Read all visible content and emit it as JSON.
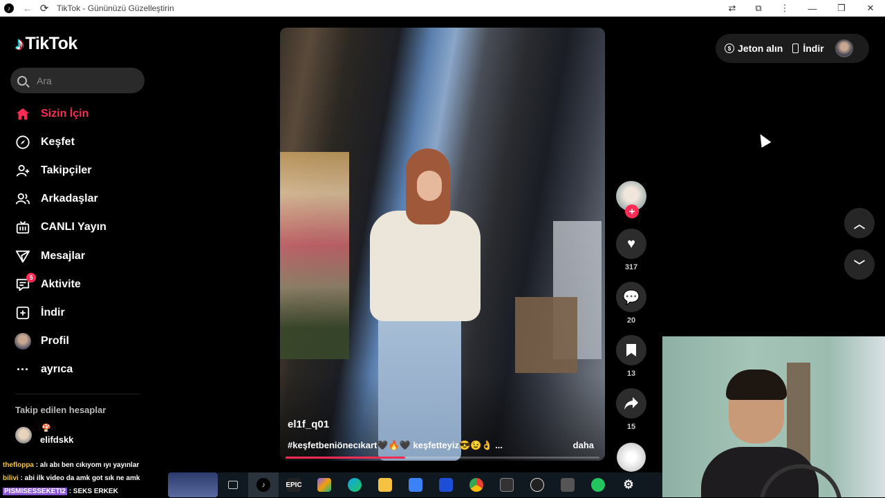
{
  "browser": {
    "title": "TikTok - Gününüzü Güzelleştirin",
    "app_icon": "tiktok-icon",
    "back_icon": "arrow-left-icon",
    "reload_icon": "reload-icon",
    "extension_icons": [
      "translate-icon",
      "puzzle-icon",
      "more-vertical-icon"
    ],
    "window_buttons": [
      "minimize-icon",
      "restore-icon",
      "close-icon"
    ]
  },
  "logo": {
    "text": "TikTok"
  },
  "search": {
    "placeholder": "Ara"
  },
  "sidebar": {
    "items": [
      {
        "label": "Sizin İçin",
        "icon": "home-icon",
        "active": true
      },
      {
        "label": "Keşfet",
        "icon": "compass-icon"
      },
      {
        "label": "Takipçiler",
        "icon": "user-add-icon"
      },
      {
        "label": "Arkadaşlar",
        "icon": "friends-icon"
      },
      {
        "label": "CANLI Yayın",
        "icon": "live-tv-icon"
      },
      {
        "label": "Mesajlar",
        "icon": "send-icon"
      },
      {
        "label": "Aktivite",
        "icon": "activity-icon",
        "badge": "5"
      },
      {
        "label": "İndir",
        "icon": "plus-square-icon"
      },
      {
        "label": "Profil",
        "icon": "avatar"
      },
      {
        "label": "ayrıca",
        "icon": "more-horizontal-icon"
      }
    ],
    "following_title": "Takip edilen hesaplar",
    "following": [
      {
        "name": "elifdskk",
        "emoji": "🍄"
      }
    ]
  },
  "video": {
    "username": "el1f_q01",
    "caption": "#keşfetbeniönecıkart🖤🔥🖤 keşfetteyiz😎😉👌 ...",
    "more_label": "daha",
    "progress": 0.38
  },
  "actions": {
    "likes": "317",
    "comments": "20",
    "saves": "13",
    "shares": "15"
  },
  "topbar": {
    "coins_label": "Jeton alın",
    "download_label": "İndir"
  },
  "chat": [
    {
      "user": "thefloppa",
      "message": ": alı abı ben cıkıyom ıyı yayınlar"
    },
    {
      "user": "bilivi",
      "message": ": abi ilk video da amk got sık ne amk"
    },
    {
      "user": "PISMISESSEKETI2",
      "message": ": SEKS ERKEK"
    }
  ],
  "taskbar": {
    "icons": [
      "task-view-icon",
      "tiktok-icon",
      "epic-games-icon",
      "copilot-icon",
      "edge-icon",
      "file-explorer-icon",
      "store-icon",
      "outlook-icon",
      "chrome-icon",
      "resolve-icon",
      "obs-icon",
      "calculator-icon",
      "whatsapp-icon",
      "settings-icon"
    ],
    "epic_label": "EPIC"
  }
}
